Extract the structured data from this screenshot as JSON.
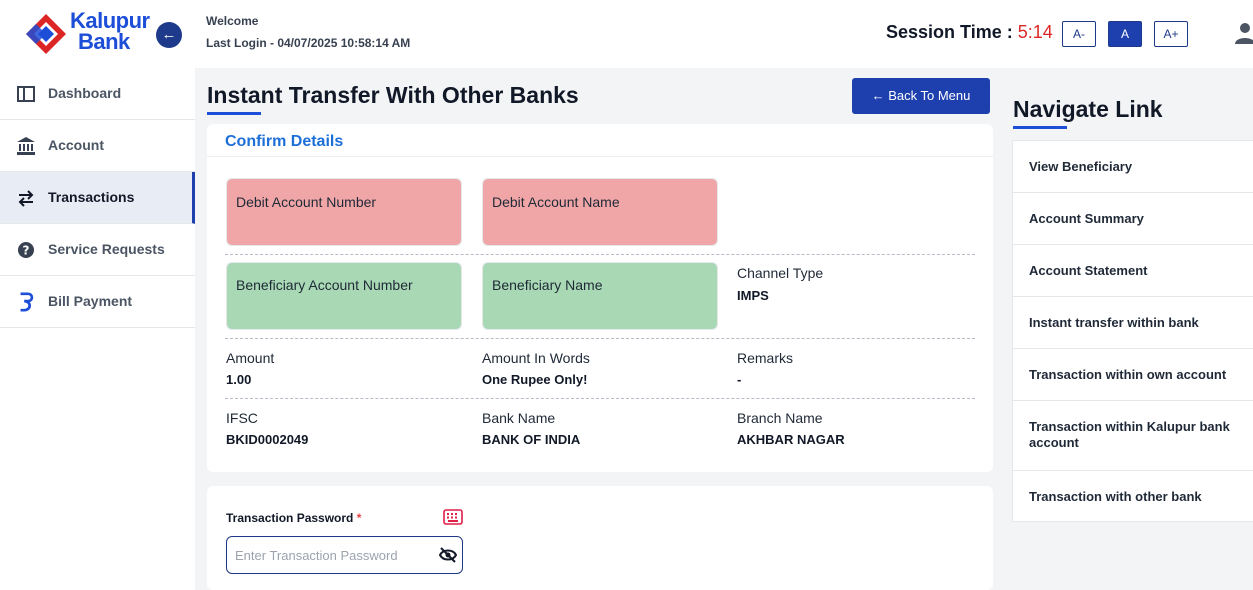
{
  "header": {
    "logo": {
      "line1": "Kalupur",
      "line2": "Bank"
    },
    "welcome": "Welcome",
    "last_login": "Last Login - 04/07/2025 10:58:14 AM",
    "session_label": "Session Time : ",
    "session_time": "5:14",
    "font_buttons": [
      "A-",
      "A",
      "A+"
    ]
  },
  "sidebar": {
    "items": [
      {
        "label": "Dashboard",
        "icon": "dashboard-icon"
      },
      {
        "label": "Account",
        "icon": "bank-icon"
      },
      {
        "label": "Transactions",
        "icon": "transfer-icon",
        "active": true
      },
      {
        "label": "Service Requests",
        "icon": "help-icon"
      },
      {
        "label": "Bill Payment",
        "icon": "bill-icon"
      }
    ]
  },
  "main": {
    "title": "Instant Transfer With Other Banks",
    "back_button": "← Back To Menu",
    "card_title": "Confirm Details",
    "debit_account_number_label": "Debit Account Number",
    "debit_account_name_label": "Debit Account Name",
    "beneficiary_account_number_label": "Beneficiary Account Number",
    "beneficiary_name_label": "Beneficiary Name",
    "channel_type": {
      "label": "Channel Type",
      "value": "IMPS"
    },
    "amount": {
      "label": "Amount",
      "value": "1.00"
    },
    "amount_in_words": {
      "label": "Amount In Words",
      "value": "One Rupee Only!"
    },
    "remarks": {
      "label": "Remarks",
      "value": "-"
    },
    "ifsc": {
      "label": "IFSC",
      "value": "BKID0002049"
    },
    "bank_name": {
      "label": "Bank Name",
      "value": "BANK OF INDIA"
    },
    "branch_name": {
      "label": "Branch Name",
      "value": "AKHBAR NAGAR"
    },
    "password": {
      "label": "Transaction Password",
      "required_mark": "*",
      "placeholder": "Enter Transaction Password"
    }
  },
  "navigate": {
    "title": "Navigate Link",
    "items": [
      "View Beneficiary",
      "Account Summary",
      "Account Statement",
      "Instant transfer within bank",
      "Transaction within own account",
      "Transaction within Kalupur bank account",
      "Transaction with other bank"
    ]
  },
  "colors": {
    "primary": "#1e40af",
    "accent_blue": "#1d6fd8",
    "session_red": "#dc2626",
    "debit_box": "#f0a6a6",
    "beneficiary_box": "#a8d9b4"
  }
}
